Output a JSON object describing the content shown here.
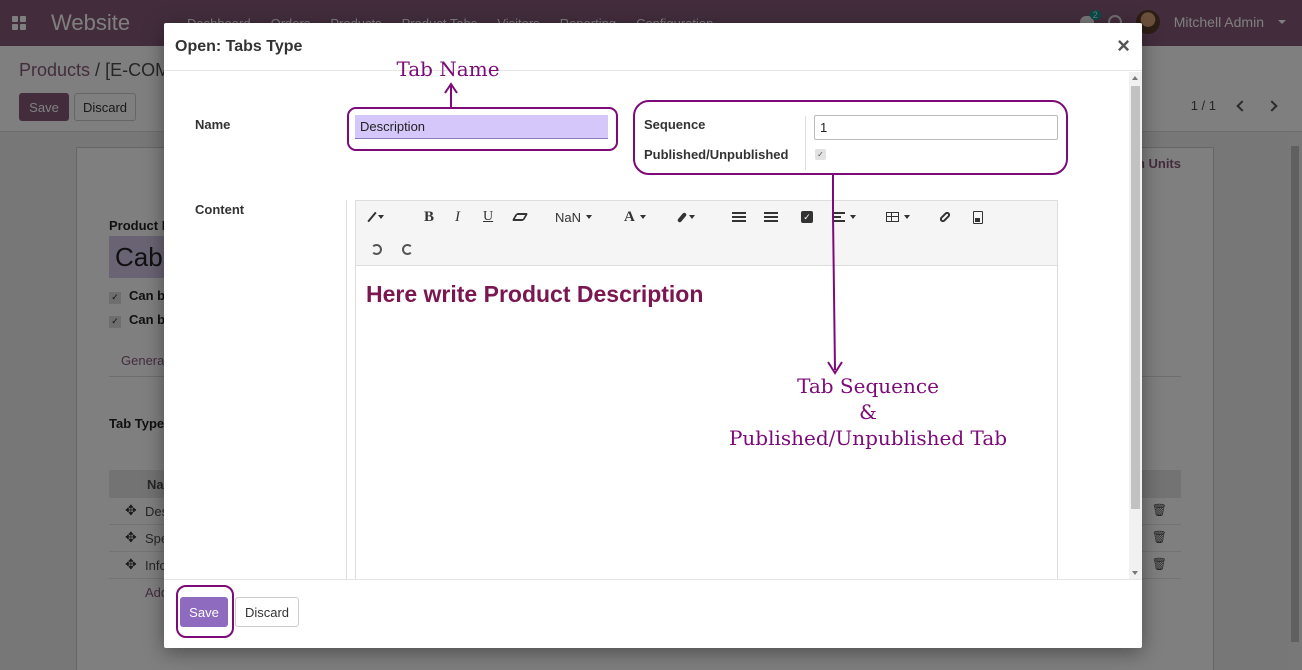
{
  "topbar": {
    "app_name": "Website",
    "menu": [
      "Dashboard",
      "Orders",
      "Products",
      "Product Tabs",
      "Visitors",
      "Reporting",
      "Configuration"
    ],
    "chat_count": "2",
    "user_name": "Mitchell Admin"
  },
  "control_panel": {
    "breadcrumb_parent": "Products",
    "breadcrumb_separator": " / ",
    "breadcrumb_current": "[E-COM",
    "save_label": "Save",
    "discard_label": "Discard",
    "pager": "1 / 1"
  },
  "sheet": {
    "stat_button": "n Units",
    "product_name_label": "Product N",
    "product_name_value": "Cabi",
    "check1_label": "Can b",
    "check2_label": "Can b",
    "tab_general": "Genera",
    "tab_types_label": "Tab Type",
    "o2m_header": "Na",
    "o2m_rows": [
      "Des",
      "Spe",
      "Info"
    ],
    "o2m_add": "Add"
  },
  "modal": {
    "title": "Open: Tabs Type",
    "close_glyph": "×",
    "name_label": "Name",
    "name_value": "Description",
    "sequence_label": "Sequence",
    "sequence_value": "1",
    "published_label": "Published/Unpublished",
    "published_checked": true,
    "content_label": "Content",
    "toolbar": {
      "font_size": "NaN"
    },
    "content_heading": "Here write Product Description",
    "footer_save": "Save",
    "footer_discard": "Discard"
  },
  "annotations": {
    "tab_name": "Tab Name",
    "tab_sequence_line1": "Tab Sequence",
    "tab_sequence_line2": "&",
    "tab_sequence_line3": "Published/Unpublished Tab",
    "color": "#7c0a78"
  },
  "colors": {
    "brand": "#875a7b",
    "name_field_bg": "#d6c7fa",
    "save_button": "#8f6bbf",
    "heading": "#7a1650"
  }
}
